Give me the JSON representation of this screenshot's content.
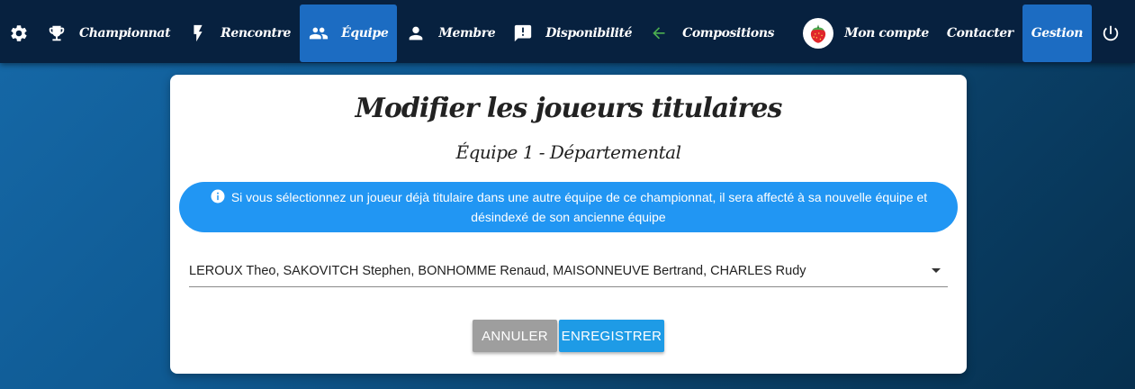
{
  "navbar": {
    "left": [
      {
        "icon": "gear-icon",
        "label": ""
      },
      {
        "icon": "trophy-icon",
        "label": "Championnat"
      },
      {
        "icon": "bolt-icon",
        "label": "Rencontre"
      },
      {
        "icon": "people-icon",
        "label": "Équipe",
        "active": true
      },
      {
        "icon": "person-icon",
        "label": "Membre"
      },
      {
        "icon": "alert-message-icon",
        "label": "Disponibilité"
      },
      {
        "icon": "arrow-left-icon",
        "label": "Compositions"
      }
    ],
    "right": [
      {
        "icon": "strawberry-avatar",
        "label": "Mon compte"
      },
      {
        "label": "Contacter"
      },
      {
        "label": "Gestion",
        "active": true
      },
      {
        "icon": "power-icon",
        "label": ""
      }
    ],
    "accent_color": "#1c6cc2",
    "background_color": "#07213f"
  },
  "dialog": {
    "title": "Modifier les joueurs titulaires",
    "subtitle": "Équipe 1 - Départemental",
    "alert": "Si vous sélectionnez un joueur déjà titulaire dans une autre équipe de ce championnat, il sera affecté à sa nouvelle équipe et désindexé de son ancienne équipe",
    "alert_color": "#2196f3",
    "select_value": "LEROUX Theo, SAKOVITCH Stephen, BONHOMME Renaud, MAISONNEUVE Bertrand, CHARLES Rudy",
    "cancel_label": "ANNULER",
    "save_label": "ENREGISTRER"
  }
}
